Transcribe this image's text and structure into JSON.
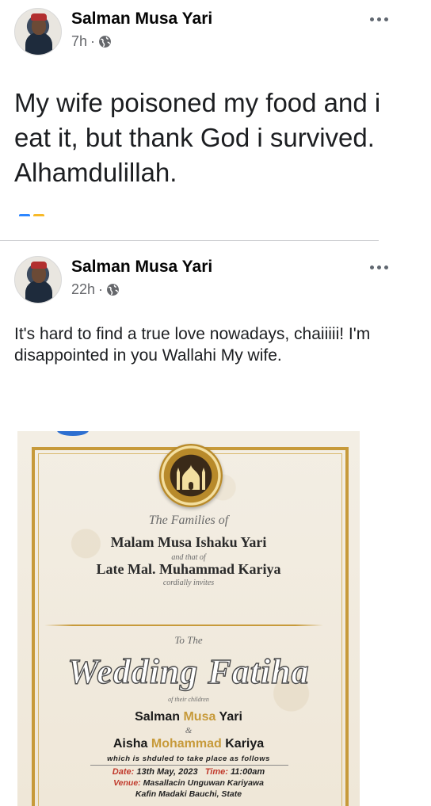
{
  "posts": [
    {
      "author": "Salman Musa Yari",
      "time": "7h",
      "separator": "·",
      "privacy_icon": "globe-icon",
      "text": "My wife poisoned my food and i eat it, but thank God i survived. Alhamdulillah."
    },
    {
      "author": "Salman Musa Yari",
      "time": "22h",
      "separator": "·",
      "privacy_icon": "globe-icon",
      "text": "It's hard to find a true love nowadays, chaiiiii! I'm disappointed in you Wallahi My wife.",
      "image": {
        "families_intro": "The Families of",
        "family1": "Malam Musa Ishaku Yari",
        "and_that_of": "and that of",
        "family2": "Late Mal. Muhammad Kariya",
        "cordially": "cordially invites",
        "to_the": "To The",
        "event_title": "Wedding Fatiha",
        "of_their_children": "of their children",
        "groom_first": "Salman",
        "groom_middle": "Musa",
        "groom_last": "Yari",
        "ampersand": "&",
        "bride_first": "Aisha",
        "bride_middle": "Mohammad",
        "bride_last": "Kariya",
        "schedule_note": "which is shduled to take place as follows",
        "date_label": "Date:",
        "date_value": "13th May, 2023",
        "time_label": "Time:",
        "time_value": "11:00am",
        "venue_label": "Venue:",
        "venue_value": "Masallacin Unguwan Kariyawa",
        "venue_line2": "Kafin Madaki Bauchi, State"
      }
    }
  ],
  "colors": {
    "name": "#050505",
    "meta": "#65676b",
    "divider": "#cfd0d3",
    "gold": "#c79a3a",
    "red_label": "#c0392b"
  }
}
